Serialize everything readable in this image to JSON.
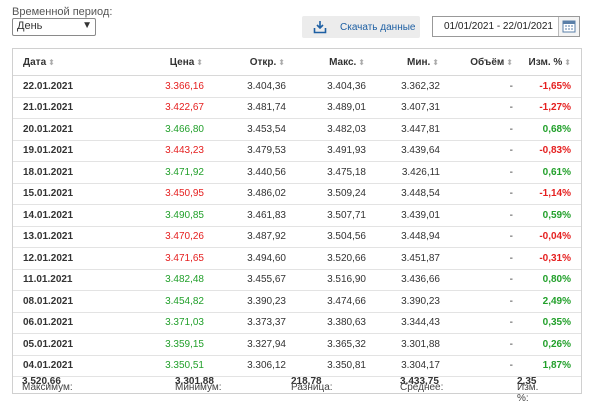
{
  "period": {
    "label": "Временной период:",
    "selected": "День"
  },
  "download": {
    "label": "Скачать данные"
  },
  "date_range": {
    "value": "01/01/2021 - 22/01/2021"
  },
  "table": {
    "headers": {
      "date": "Дата",
      "price": "Цена",
      "open": "Откр.",
      "high": "Макс.",
      "low": "Мин.",
      "volume": "Объём",
      "change": "Изм. %"
    },
    "rows": [
      {
        "date": "22.01.2021",
        "price": "3.366,16",
        "open": "3.404,36",
        "high": "3.404,36",
        "low": "3.362,32",
        "volume": "-",
        "change": "-1,65%",
        "dir": "down"
      },
      {
        "date": "21.01.2021",
        "price": "3.422,67",
        "open": "3.481,74",
        "high": "3.489,01",
        "low": "3.407,31",
        "volume": "-",
        "change": "-1,27%",
        "dir": "down"
      },
      {
        "date": "20.01.2021",
        "price": "3.466,80",
        "open": "3.453,54",
        "high": "3.482,03",
        "low": "3.447,81",
        "volume": "-",
        "change": "0,68%",
        "dir": "up"
      },
      {
        "date": "19.01.2021",
        "price": "3.443,23",
        "open": "3.479,53",
        "high": "3.491,93",
        "low": "3.439,64",
        "volume": "-",
        "change": "-0,83%",
        "dir": "down"
      },
      {
        "date": "18.01.2021",
        "price": "3.471,92",
        "open": "3.440,56",
        "high": "3.475,18",
        "low": "3.426,11",
        "volume": "-",
        "change": "0,61%",
        "dir": "up"
      },
      {
        "date": "15.01.2021",
        "price": "3.450,95",
        "open": "3.486,02",
        "high": "3.509,24",
        "low": "3.448,54",
        "volume": "-",
        "change": "-1,14%",
        "dir": "down"
      },
      {
        "date": "14.01.2021",
        "price": "3.490,85",
        "open": "3.461,83",
        "high": "3.507,71",
        "low": "3.439,01",
        "volume": "-",
        "change": "0,59%",
        "dir": "up"
      },
      {
        "date": "13.01.2021",
        "price": "3.470,26",
        "open": "3.487,92",
        "high": "3.504,56",
        "low": "3.448,94",
        "volume": "-",
        "change": "-0,04%",
        "dir": "down"
      },
      {
        "date": "12.01.2021",
        "price": "3.471,65",
        "open": "3.494,60",
        "high": "3.520,66",
        "low": "3.451,87",
        "volume": "-",
        "change": "-0,31%",
        "dir": "down"
      },
      {
        "date": "11.01.2021",
        "price": "3.482,48",
        "open": "3.455,67",
        "high": "3.516,90",
        "low": "3.436,66",
        "volume": "-",
        "change": "0,80%",
        "dir": "up"
      },
      {
        "date": "08.01.2021",
        "price": "3.454,82",
        "open": "3.390,23",
        "high": "3.474,66",
        "low": "3.390,23",
        "volume": "-",
        "change": "2,49%",
        "dir": "up"
      },
      {
        "date": "06.01.2021",
        "price": "3.371,03",
        "open": "3.373,37",
        "high": "3.380,63",
        "low": "3.344,43",
        "volume": "-",
        "change": "0,35%",
        "dir": "up"
      },
      {
        "date": "05.01.2021",
        "price": "3.359,15",
        "open": "3.327,94",
        "high": "3.365,32",
        "low": "3.301,88",
        "volume": "-",
        "change": "0,26%",
        "dir": "up"
      },
      {
        "date": "04.01.2021",
        "price": "3.350,51",
        "open": "3.306,12",
        "high": "3.350,81",
        "low": "3.304,17",
        "volume": "-",
        "change": "1,87%",
        "dir": "up"
      }
    ]
  },
  "summary": {
    "max_label": "Максимум:",
    "max_value": "3.520,66",
    "min_label": "Минимум:",
    "min_value": "3.301,88",
    "diff_label": "Разница:",
    "diff_value": "218,78",
    "avg_label": "Среднее:",
    "avg_value": "3.433,75",
    "chg_label": "Изм. %:",
    "chg_value": "2,35"
  },
  "colors": {
    "up": "#22a02b",
    "down": "#e52020",
    "link": "#1d5fa3"
  }
}
